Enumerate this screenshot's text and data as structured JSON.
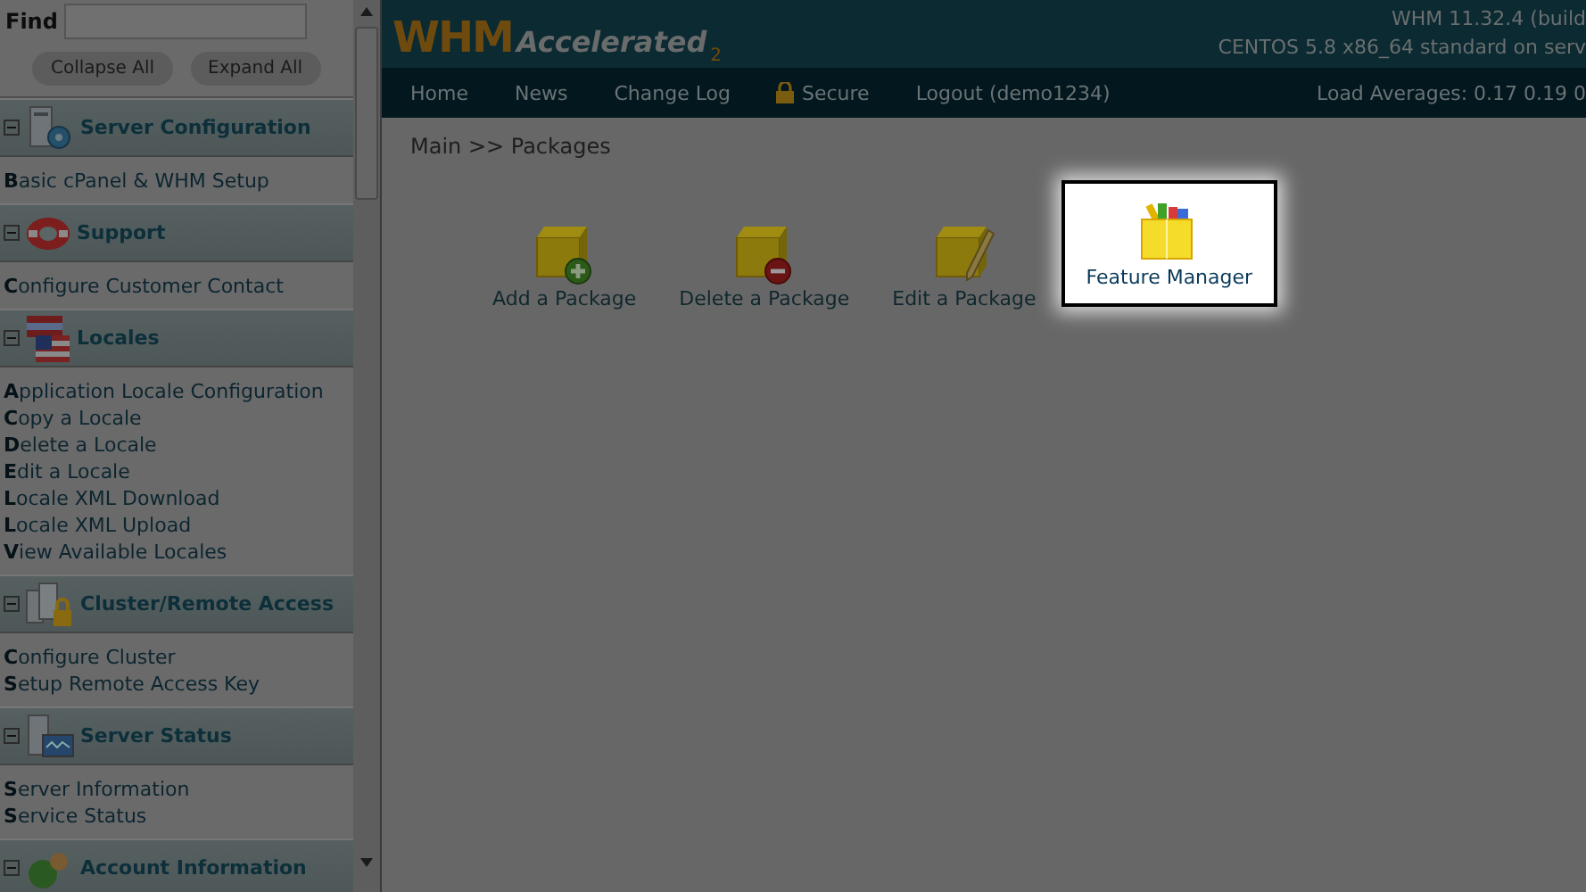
{
  "sidebar": {
    "find": {
      "label": "Find"
    },
    "buttons": [
      "Collapse All",
      "Expand All"
    ],
    "sections": [
      {
        "title": "Server Configuration",
        "kind": "server",
        "expanded": true,
        "items": [
          "**B**asic cPanel & WHM Setup"
        ]
      },
      {
        "title": "Support",
        "kind": "lifebuoy",
        "expanded": true,
        "items": [
          "**C**onfigure Customer Contact"
        ]
      },
      {
        "title": "Locales",
        "kind": "flag",
        "expanded": true,
        "items": [
          "**A**pplication Locale Configuration",
          "**C**opy a Locale",
          "**D**elete a Locale",
          "**E**dit a Locale",
          "**L**ocale XML Download",
          "**L**ocale XML Upload",
          "**V**iew Available Locales"
        ]
      },
      {
        "title": "Cluster/Remote Access",
        "kind": "cluster",
        "expanded": true,
        "items": [
          "**C**onfigure Cluster",
          "**S**etup Remote Access Key"
        ]
      },
      {
        "title": "Server Status",
        "kind": "status",
        "expanded": true,
        "items": [
          "**S**erver Information",
          "**S**ervice Status"
        ]
      },
      {
        "title": "Account Information",
        "kind": "account",
        "expanded": true
      }
    ]
  },
  "header": {
    "logo": "WHM",
    "logo_sub": "Accelerated",
    "logo_sup": "2",
    "version": "WHM 11.32.4 (build",
    "os": "CENTOS 5.8 x86_64 standard on serv"
  },
  "nav": {
    "items": [
      {
        "label": "Home",
        "kind": "link"
      },
      {
        "label": "News",
        "kind": "link"
      },
      {
        "label": "Change Log",
        "kind": "link"
      },
      {
        "label": "Secure",
        "kind": "lock"
      },
      {
        "label": "Logout (demo1234)",
        "kind": "link"
      }
    ],
    "load": "Load Averages: 0.17 0.19 0"
  },
  "breadcrumb": "Main >> Packages",
  "packages": [
    {
      "label": "Add a Package",
      "kind": "add",
      "highlighted": false
    },
    {
      "label": "Delete a Package",
      "kind": "delete",
      "highlighted": false
    },
    {
      "label": "Edit a Package",
      "kind": "edit",
      "highlighted": false
    },
    {
      "label": "Feature Manager",
      "kind": "features",
      "highlighted": true
    }
  ]
}
